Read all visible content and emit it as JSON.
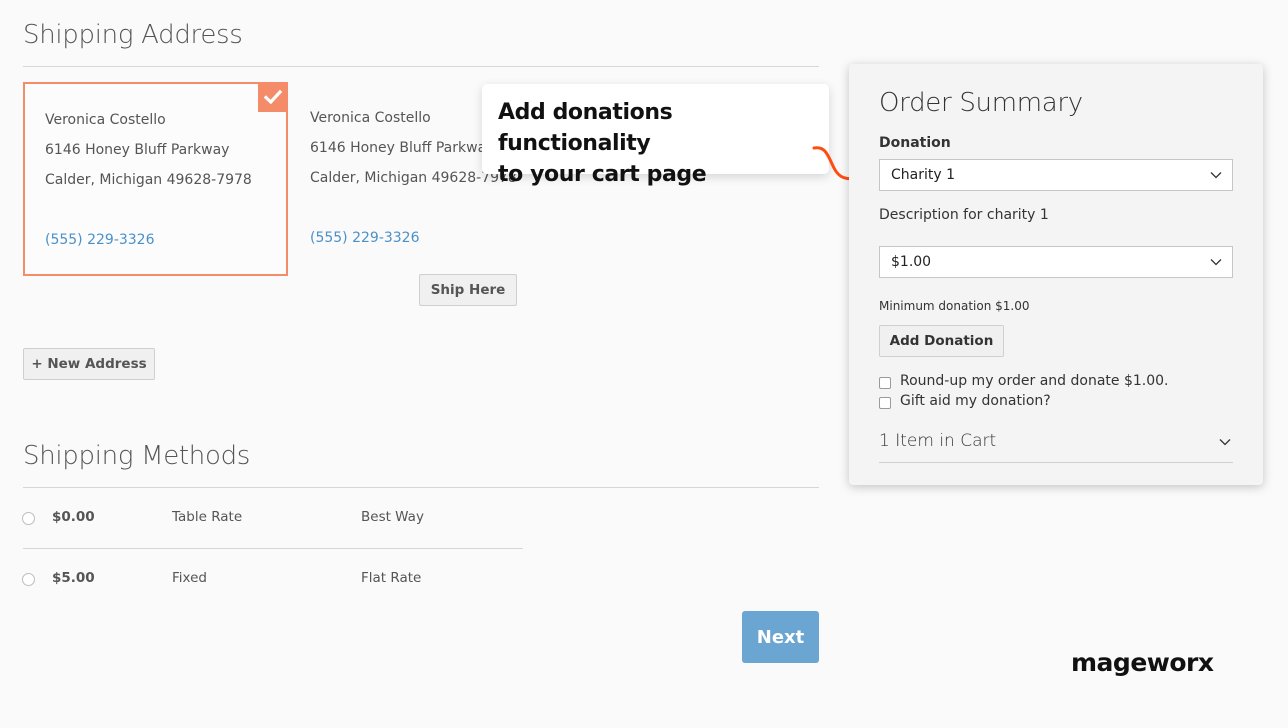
{
  "shipping_address": {
    "title": "Shipping Address",
    "addresses": [
      {
        "name": "Veronica Costello",
        "street": "6146 Honey Bluff Parkway",
        "city_line": "Calder, Michigan 49628-7978",
        "phone": "(555) 229-3326",
        "selected": true
      },
      {
        "name": "Veronica Costello",
        "street": "6146 Honey Bluff Parkway",
        "city_line": "Calder, Michigan 49628-7978",
        "phone": "(555) 229-3326",
        "selected": false
      }
    ],
    "ship_here_label": "Ship Here",
    "new_address_label": "+ New Address"
  },
  "shipping_methods": {
    "title": "Shipping Methods",
    "rows": [
      {
        "price": "$0.00",
        "method": "Table Rate",
        "carrier": "Best Way"
      },
      {
        "price": "$5.00",
        "method": "Fixed",
        "carrier": "Flat Rate"
      }
    ],
    "next_label": "Next"
  },
  "callout": {
    "line1": "Add donations functionality",
    "line2": "to your cart page"
  },
  "order_summary": {
    "title": "Order Summary",
    "donation_label": "Donation",
    "charity_selected": "Charity 1",
    "description": "Description for charity 1",
    "amount_selected": "$1.00",
    "minimum_text": "Minimum donation $1.00",
    "add_donation_label": "Add Donation",
    "roundup_label": "Round-up my order and donate $1.00.",
    "giftaid_label": "Gift aid my donation?",
    "cart_toggle_label": "1 Item in Cart"
  },
  "brand": {
    "logo_text": "mageworx"
  },
  "colors": {
    "accent_orange": "#f58c69",
    "arrow_orange": "#ff4d12",
    "link_blue": "#4a90c9",
    "next_button": "#6ba5d2"
  }
}
